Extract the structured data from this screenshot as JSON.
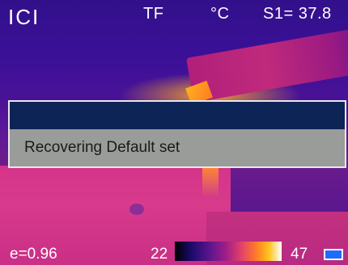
{
  "hud": {
    "brand": "ICI",
    "mode": "TF",
    "unit": "°C",
    "spot_reading": "S1= 37.8"
  },
  "dialog": {
    "message": "Recovering Default set"
  },
  "footer": {
    "emissivity": "e=0.96",
    "scale_min": "22",
    "scale_max": "47"
  },
  "colors": {
    "dialog_header": "#0d2457",
    "dialog_body": "#9a9c9a",
    "battery": "#1e6cff"
  }
}
